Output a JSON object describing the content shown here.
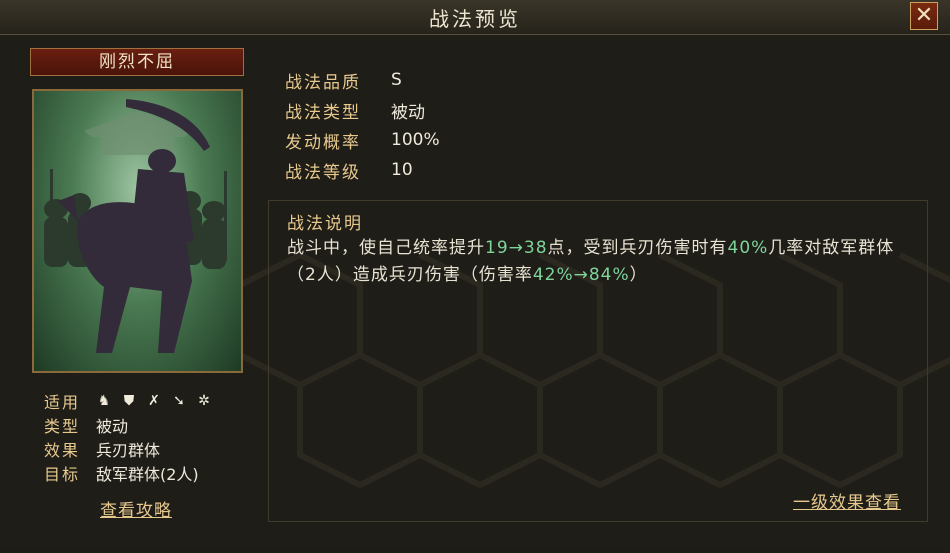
{
  "window": {
    "title": "战法预览",
    "close_icon": "close-icon"
  },
  "card": {
    "name": "刚烈不屈"
  },
  "info": [
    {
      "label": "战法品质",
      "value": "S"
    },
    {
      "label": "战法类型",
      "value": "被动"
    },
    {
      "label": "发动概率",
      "value": "100%"
    },
    {
      "label": "战法等级",
      "value": "10"
    }
  ],
  "description": {
    "title": "战法说明",
    "parts": [
      {
        "text": "战斗中，使自己统率提升",
        "hl": false
      },
      {
        "text": "19→38",
        "hl": true
      },
      {
        "text": "点，受到兵刃伤害时有",
        "hl": false
      },
      {
        "text": "40%",
        "hl": true
      },
      {
        "text": "几率对敌军群体（2人）造成兵刃伤害（伤害率",
        "hl": false
      },
      {
        "text": "42%→84%",
        "hl": true
      },
      {
        "text": "）",
        "hl": false
      }
    ],
    "level1_link": "一级效果查看"
  },
  "attributes": {
    "applicable_label": "适用",
    "troop_icons": [
      "cavalry-icon",
      "shield-icon",
      "bow-icon",
      "spear-icon",
      "siege-icon"
    ],
    "type_label": "类型",
    "type_value": "被动",
    "effect_label": "效果",
    "effect_value": "兵刃群体",
    "target_label": "目标",
    "target_value": "敌军群体(2人)"
  },
  "guide_link": "查看攻略",
  "colors": {
    "accent_gold": "#e7c98e",
    "highlight_green": "#7fd49a",
    "plate_red": "#6a1e10"
  }
}
